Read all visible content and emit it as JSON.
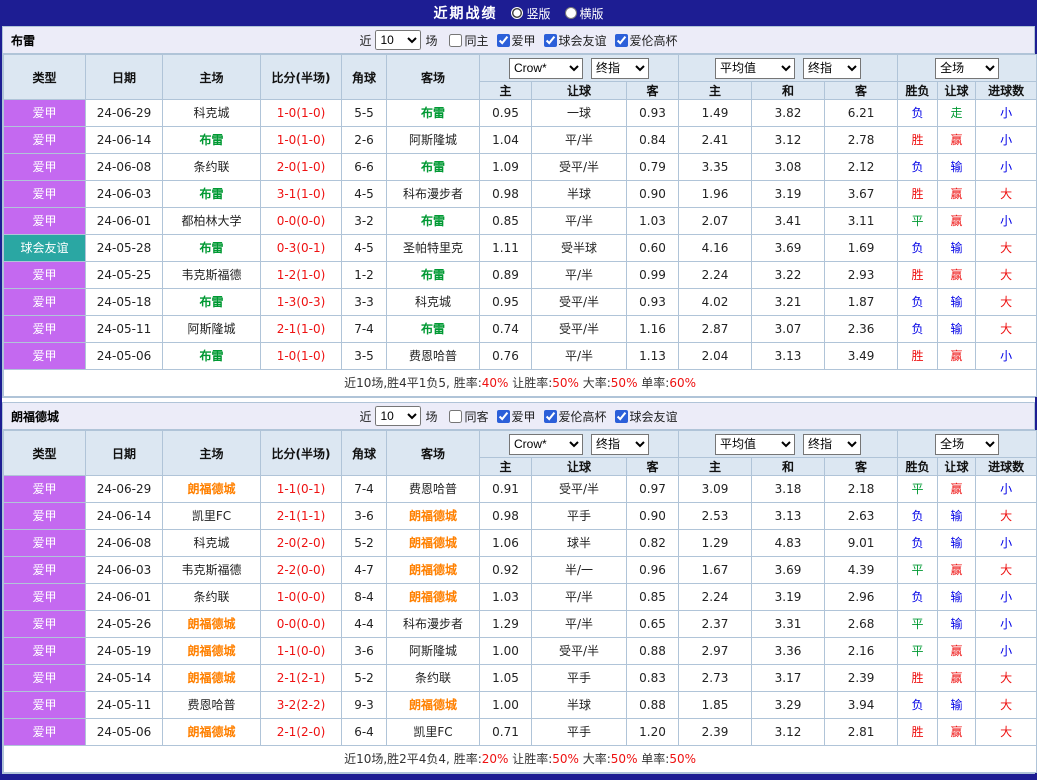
{
  "topbar": {
    "title": "近期战绩",
    "radios": [
      {
        "label": "竖版",
        "checked": true
      },
      {
        "label": "横版",
        "checked": false
      }
    ]
  },
  "labels": {
    "recent_prefix": "近",
    "recent_suffix": "场"
  },
  "columns": [
    "类型",
    "日期",
    "主场",
    "比分(半场)",
    "角球",
    "客场",
    "主",
    "让球",
    "客",
    "主",
    "和",
    "客",
    "胜负",
    "让球",
    "进球数"
  ],
  "colors": {
    "league_badge": "#c469f0",
    "friendly_badge": "#2aa7a3",
    "win": "#ee1111",
    "draw": "#009933",
    "lose": "#0000e6",
    "score": "#ee1111"
  },
  "sections": [
    {
      "team": "布雷",
      "team_color": "#009933",
      "filter": {
        "recent": "10",
        "checkboxes": [
          {
            "label": "同主",
            "checked": false
          },
          {
            "label": "爱甲",
            "checked": true
          },
          {
            "label": "球会友谊",
            "checked": true
          },
          {
            "label": "爱伦高杯",
            "checked": true
          }
        ]
      },
      "dropdowns": {
        "company": "Crow*",
        "company_time": "终指",
        "avg": "平均值",
        "avg_time": "终指",
        "scope": "全场"
      },
      "rows": [
        {
          "type": "爱甲",
          "type_style": "league",
          "date": "24-06-29",
          "home": "科克城",
          "home_is_team": false,
          "score": "1-0(1-0)",
          "corner": "5-5",
          "away": "布雷",
          "away_is_team": true,
          "o1": "0.95",
          "handicap": "一球",
          "o2": "0.93",
          "a1": "1.49",
          "a2": "3.82",
          "a3": "6.21",
          "result": "负",
          "handicap_result": "走",
          "goals": "小"
        },
        {
          "type": "爱甲",
          "type_style": "league",
          "date": "24-06-14",
          "home": "布雷",
          "home_is_team": true,
          "score": "1-0(1-0)",
          "corner": "2-6",
          "away": "阿斯隆城",
          "away_is_team": false,
          "o1": "1.04",
          "handicap": "平/半",
          "o2": "0.84",
          "a1": "2.41",
          "a2": "3.12",
          "a3": "2.78",
          "result": "胜",
          "handicap_result": "赢",
          "goals": "小"
        },
        {
          "type": "爱甲",
          "type_style": "league",
          "date": "24-06-08",
          "home": "条约联",
          "home_is_team": false,
          "score": "2-0(1-0)",
          "corner": "6-6",
          "away": "布雷",
          "away_is_team": true,
          "o1": "1.09",
          "handicap": "受平/半",
          "o2": "0.79",
          "a1": "3.35",
          "a2": "3.08",
          "a3": "2.12",
          "result": "负",
          "handicap_result": "输",
          "goals": "小"
        },
        {
          "type": "爱甲",
          "type_style": "league",
          "date": "24-06-03",
          "home": "布雷",
          "home_is_team": true,
          "score": "3-1(1-0)",
          "corner": "4-5",
          "away": "科布漫步者",
          "away_is_team": false,
          "o1": "0.98",
          "handicap": "半球",
          "o2": "0.90",
          "a1": "1.96",
          "a2": "3.19",
          "a3": "3.67",
          "result": "胜",
          "handicap_result": "赢",
          "goals": "大"
        },
        {
          "type": "爱甲",
          "type_style": "league",
          "date": "24-06-01",
          "home": "都柏林大学",
          "home_is_team": false,
          "score": "0-0(0-0)",
          "corner": "3-2",
          "away": "布雷",
          "away_is_team": true,
          "o1": "0.85",
          "handicap": "平/半",
          "o2": "1.03",
          "a1": "2.07",
          "a2": "3.41",
          "a3": "3.11",
          "result": "平",
          "handicap_result": "赢",
          "goals": "小"
        },
        {
          "type": "球会友谊",
          "type_style": "friendly",
          "date": "24-05-28",
          "home": "布雷",
          "home_is_team": true,
          "score": "0-3(0-1)",
          "corner": "4-5",
          "away": "圣帕特里克",
          "away_is_team": false,
          "o1": "1.11",
          "handicap": "受半球",
          "o2": "0.60",
          "a1": "4.16",
          "a2": "3.69",
          "a3": "1.69",
          "result": "负",
          "handicap_result": "输",
          "goals": "大"
        },
        {
          "type": "爱甲",
          "type_style": "league",
          "date": "24-05-25",
          "home": "韦克斯福德",
          "home_is_team": false,
          "score": "1-2(1-0)",
          "corner": "1-2",
          "away": "布雷",
          "away_is_team": true,
          "o1": "0.89",
          "handicap": "平/半",
          "o2": "0.99",
          "a1": "2.24",
          "a2": "3.22",
          "a3": "2.93",
          "result": "胜",
          "handicap_result": "赢",
          "goals": "大"
        },
        {
          "type": "爱甲",
          "type_style": "league",
          "date": "24-05-18",
          "home": "布雷",
          "home_is_team": true,
          "score": "1-3(0-3)",
          "corner": "3-3",
          "away": "科克城",
          "away_is_team": false,
          "o1": "0.95",
          "handicap": "受平/半",
          "o2": "0.93",
          "a1": "4.02",
          "a2": "3.21",
          "a3": "1.87",
          "result": "负",
          "handicap_result": "输",
          "goals": "大"
        },
        {
          "type": "爱甲",
          "type_style": "league",
          "date": "24-05-11",
          "home": "阿斯隆城",
          "home_is_team": false,
          "score": "2-1(1-0)",
          "corner": "7-4",
          "away": "布雷",
          "away_is_team": true,
          "o1": "0.74",
          "handicap": "受平/半",
          "o2": "1.16",
          "a1": "2.87",
          "a2": "3.07",
          "a3": "2.36",
          "result": "负",
          "handicap_result": "输",
          "goals": "大"
        },
        {
          "type": "爱甲",
          "type_style": "league",
          "date": "24-05-06",
          "home": "布雷",
          "home_is_team": true,
          "score": "1-0(1-0)",
          "corner": "3-5",
          "away": "费恩哈普",
          "away_is_team": false,
          "o1": "0.76",
          "handicap": "平/半",
          "o2": "1.13",
          "a1": "2.04",
          "a2": "3.13",
          "a3": "3.49",
          "result": "胜",
          "handicap_result": "赢",
          "goals": "小"
        }
      ],
      "footer": {
        "summary": "近10场,胜4平1负5,",
        "stats": [
          {
            "label": "胜率:",
            "value": "40%"
          },
          {
            "label": "让胜率:",
            "value": "50%"
          },
          {
            "label": "大率:",
            "value": "50%"
          },
          {
            "label": "单率:",
            "value": "60%"
          }
        ]
      }
    },
    {
      "team": "朗福德城",
      "team_color": "#ff8000",
      "filter": {
        "recent": "10",
        "checkboxes": [
          {
            "label": "同客",
            "checked": false
          },
          {
            "label": "爱甲",
            "checked": true
          },
          {
            "label": "爱伦高杯",
            "checked": true
          },
          {
            "label": "球会友谊",
            "checked": true
          }
        ]
      },
      "dropdowns": {
        "company": "Crow*",
        "company_time": "终指",
        "avg": "平均值",
        "avg_time": "终指",
        "scope": "全场"
      },
      "rows": [
        {
          "type": "爱甲",
          "type_style": "league",
          "date": "24-06-29",
          "home": "朗福德城",
          "home_is_team": true,
          "score": "1-1(0-1)",
          "corner": "7-4",
          "away": "费恩哈普",
          "away_is_team": false,
          "o1": "0.91",
          "handicap": "受平/半",
          "o2": "0.97",
          "a1": "3.09",
          "a2": "3.18",
          "a3": "2.18",
          "result": "平",
          "handicap_result": "赢",
          "goals": "小"
        },
        {
          "type": "爱甲",
          "type_style": "league",
          "date": "24-06-14",
          "home": "凯里FC",
          "home_is_team": false,
          "score": "2-1(1-1)",
          "corner": "3-6",
          "away": "朗福德城",
          "away_is_team": true,
          "o1": "0.98",
          "handicap": "平手",
          "o2": "0.90",
          "a1": "2.53",
          "a2": "3.13",
          "a3": "2.63",
          "result": "负",
          "handicap_result": "输",
          "goals": "大"
        },
        {
          "type": "爱甲",
          "type_style": "league",
          "date": "24-06-08",
          "home": "科克城",
          "home_is_team": false,
          "score": "2-0(2-0)",
          "corner": "5-2",
          "away": "朗福德城",
          "away_is_team": true,
          "o1": "1.06",
          "handicap": "球半",
          "o2": "0.82",
          "a1": "1.29",
          "a2": "4.83",
          "a3": "9.01",
          "result": "负",
          "handicap_result": "输",
          "goals": "小"
        },
        {
          "type": "爱甲",
          "type_style": "league",
          "date": "24-06-03",
          "home": "韦克斯福德",
          "home_is_team": false,
          "score": "2-2(0-0)",
          "corner": "4-7",
          "away": "朗福德城",
          "away_is_team": true,
          "o1": "0.92",
          "handicap": "半/一",
          "o2": "0.96",
          "a1": "1.67",
          "a2": "3.69",
          "a3": "4.39",
          "result": "平",
          "handicap_result": "赢",
          "goals": "大"
        },
        {
          "type": "爱甲",
          "type_style": "league",
          "date": "24-06-01",
          "home": "条约联",
          "home_is_team": false,
          "score": "1-0(0-0)",
          "corner": "8-4",
          "away": "朗福德城",
          "away_is_team": true,
          "o1": "1.03",
          "handicap": "平/半",
          "o2": "0.85",
          "a1": "2.24",
          "a2": "3.19",
          "a3": "2.96",
          "result": "负",
          "handicap_result": "输",
          "goals": "小"
        },
        {
          "type": "爱甲",
          "type_style": "league",
          "date": "24-05-26",
          "home": "朗福德城",
          "home_is_team": true,
          "score": "0-0(0-0)",
          "corner": "4-4",
          "away": "科布漫步者",
          "away_is_team": false,
          "o1": "1.29",
          "handicap": "平/半",
          "o2": "0.65",
          "a1": "2.37",
          "a2": "3.31",
          "a3": "2.68",
          "result": "平",
          "handicap_result": "输",
          "goals": "小"
        },
        {
          "type": "爱甲",
          "type_style": "league",
          "date": "24-05-19",
          "home": "朗福德城",
          "home_is_team": true,
          "score": "1-1(0-0)",
          "corner": "3-6",
          "away": "阿斯隆城",
          "away_is_team": false,
          "o1": "1.00",
          "handicap": "受平/半",
          "o2": "0.88",
          "a1": "2.97",
          "a2": "3.36",
          "a3": "2.16",
          "result": "平",
          "handicap_result": "赢",
          "goals": "小"
        },
        {
          "type": "爱甲",
          "type_style": "league",
          "date": "24-05-14",
          "home": "朗福德城",
          "home_is_team": true,
          "score": "2-1(2-1)",
          "corner": "5-2",
          "away": "条约联",
          "away_is_team": false,
          "o1": "1.05",
          "handicap": "平手",
          "o2": "0.83",
          "a1": "2.73",
          "a2": "3.17",
          "a3": "2.39",
          "result": "胜",
          "handicap_result": "赢",
          "goals": "大"
        },
        {
          "type": "爱甲",
          "type_style": "league",
          "date": "24-05-11",
          "home": "费恩哈普",
          "home_is_team": false,
          "score": "3-2(2-2)",
          "corner": "9-3",
          "away": "朗福德城",
          "away_is_team": true,
          "o1": "1.00",
          "handicap": "半球",
          "o2": "0.88",
          "a1": "1.85",
          "a2": "3.29",
          "a3": "3.94",
          "result": "负",
          "handicap_result": "输",
          "goals": "大"
        },
        {
          "type": "爱甲",
          "type_style": "league",
          "date": "24-05-06",
          "home": "朗福德城",
          "home_is_team": true,
          "score": "2-1(2-0)",
          "corner": "6-4",
          "away": "凯里FC",
          "away_is_team": false,
          "o1": "0.71",
          "handicap": "平手",
          "o2": "1.20",
          "a1": "2.39",
          "a2": "3.12",
          "a3": "2.81",
          "result": "胜",
          "handicap_result": "赢",
          "goals": "大"
        }
      ],
      "footer": {
        "summary": "近10场,胜2平4负4,",
        "stats": [
          {
            "label": "胜率:",
            "value": "20%"
          },
          {
            "label": "让胜率:",
            "value": "50%"
          },
          {
            "label": "大率:",
            "value": "50%"
          },
          {
            "label": "单率:",
            "value": "50%"
          }
        ]
      }
    }
  ]
}
